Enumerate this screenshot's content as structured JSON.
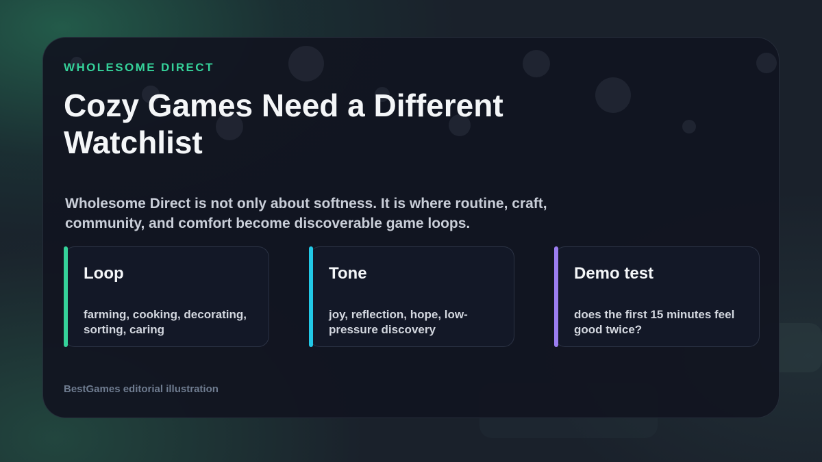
{
  "colors": {
    "eyebrow": "#35d29a",
    "loop_accent": "#35d29a",
    "tone_accent": "#22c8e6",
    "demo_accent": "#9b7df0"
  },
  "card": {
    "eyebrow": "WHOLESOME DIRECT",
    "title": "Cozy Games Need a Different Watchlist",
    "intro": "Wholesome Direct is not only about softness. It is where routine, craft, community, and comfort become discoverable game loops.",
    "features": [
      {
        "title": "Loop",
        "text": "farming, cooking, decorating, sorting, caring"
      },
      {
        "title": "Tone",
        "text": "joy, reflection, hope, low-pressure discovery"
      },
      {
        "title": "Demo test",
        "text": "does the first 15 minutes feel good twice?"
      }
    ],
    "footer": "BestGames editorial illustration"
  }
}
